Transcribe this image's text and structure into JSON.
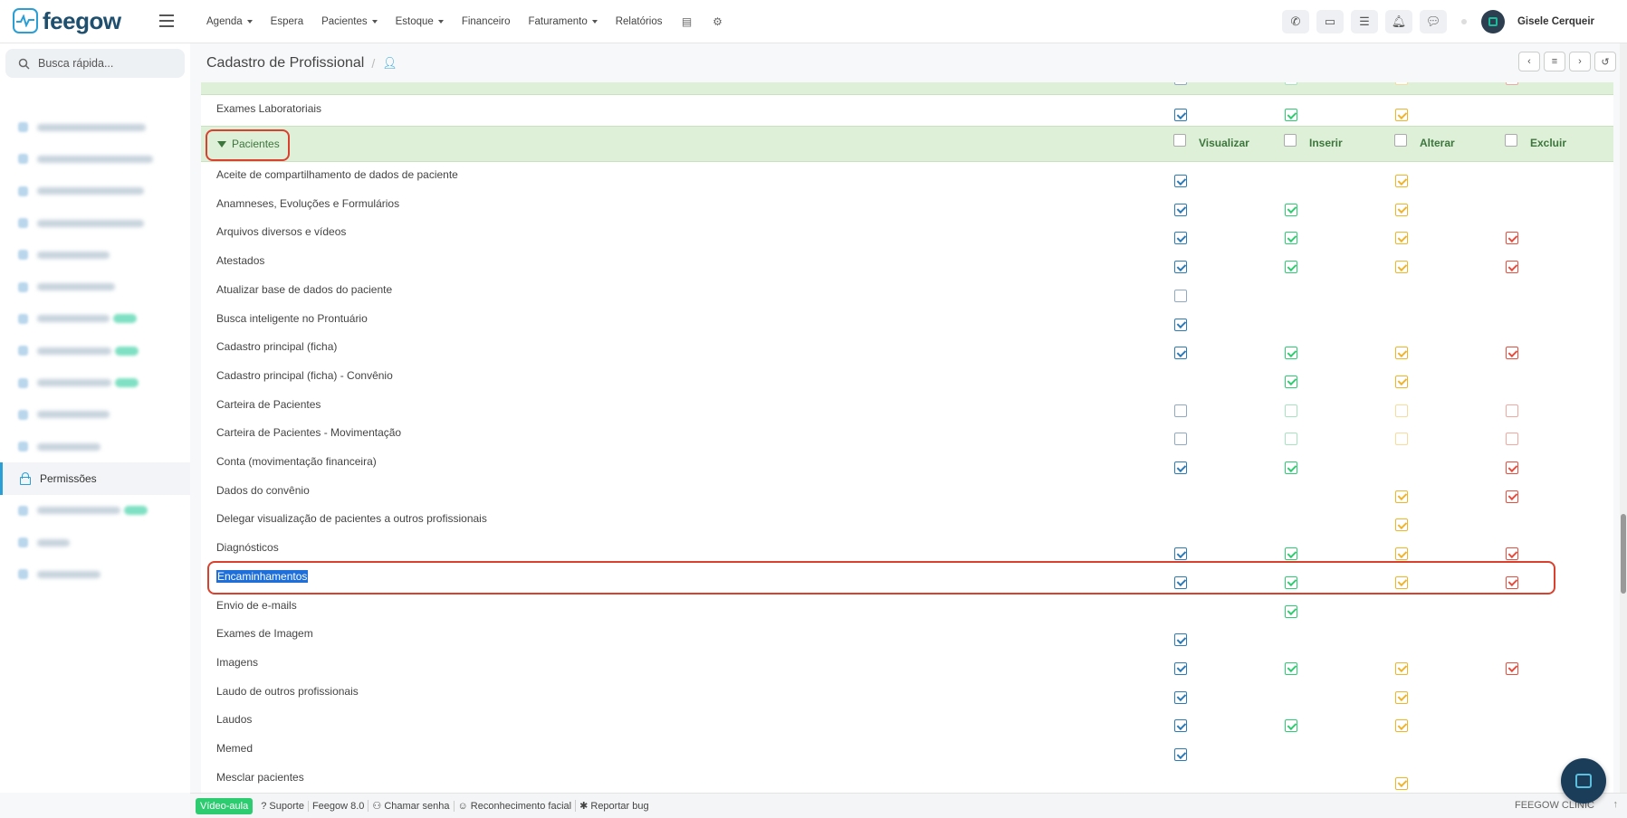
{
  "brand": {
    "name": "feegow"
  },
  "nav": [
    {
      "label": "Agenda",
      "dropdown": true
    },
    {
      "label": "Espera",
      "dropdown": false
    },
    {
      "label": "Pacientes",
      "dropdown": true
    },
    {
      "label": "Estoque",
      "dropdown": true
    },
    {
      "label": "Financeiro",
      "dropdown": false
    },
    {
      "label": "Faturamento",
      "dropdown": true
    },
    {
      "label": "Relatórios",
      "dropdown": false
    }
  ],
  "user": {
    "name": "Gisele Cerqueir"
  },
  "search": {
    "placeholder": "Busca rápida..."
  },
  "sidebar": {
    "active_label": "Permissões"
  },
  "page": {
    "title": "Cadastro de Profissional"
  },
  "group_header": {
    "title": "Pacientes",
    "columns": [
      "Visualizar",
      "Inserir",
      "Alterar",
      "Excluir"
    ]
  },
  "top_row": {
    "name": "Exames Laboratoriais",
    "checks": [
      1,
      1,
      1,
      null
    ]
  },
  "permissions": [
    {
      "name": "Aceite de compartilhamento de dados de paciente",
      "checks": [
        1,
        null,
        1,
        null
      ]
    },
    {
      "name": "Anamneses, Evoluções e Formulários",
      "checks": [
        1,
        1,
        1,
        null
      ]
    },
    {
      "name": "Arquivos diversos e vídeos",
      "checks": [
        1,
        1,
        1,
        1
      ]
    },
    {
      "name": "Atestados",
      "checks": [
        1,
        1,
        1,
        1
      ]
    },
    {
      "name": "Atualizar base de dados do paciente",
      "checks": [
        0,
        null,
        null,
        null
      ]
    },
    {
      "name": "Busca inteligente no Prontuário",
      "checks": [
        1,
        null,
        null,
        null
      ]
    },
    {
      "name": "Cadastro principal (ficha)",
      "checks": [
        1,
        1,
        1,
        1
      ]
    },
    {
      "name": "Cadastro principal (ficha) - Convênio",
      "checks": [
        null,
        1,
        1,
        null
      ]
    },
    {
      "name": "Carteira de Pacientes",
      "checks": [
        0,
        0,
        0,
        0
      ]
    },
    {
      "name": "Carteira de Pacientes - Movimentação",
      "checks": [
        0,
        0,
        0,
        0
      ]
    },
    {
      "name": "Conta (movimentação financeira)",
      "checks": [
        1,
        1,
        null,
        1
      ]
    },
    {
      "name": "Dados do convênio",
      "checks": [
        null,
        null,
        1,
        1
      ]
    },
    {
      "name": "Delegar visualização de pacientes a outros profissionais",
      "checks": [
        null,
        null,
        1,
        null
      ]
    },
    {
      "name": "Diagnósticos",
      "checks": [
        1,
        1,
        1,
        1
      ]
    },
    {
      "name": "Encaminhamentos",
      "checks": [
        1,
        1,
        1,
        1
      ],
      "selected": true
    },
    {
      "name": "Envio de e-mails",
      "checks": [
        null,
        1,
        null,
        null
      ]
    },
    {
      "name": "Exames de Imagem",
      "checks": [
        1,
        null,
        null,
        null
      ]
    },
    {
      "name": "Imagens",
      "checks": [
        1,
        1,
        1,
        1
      ]
    },
    {
      "name": "Laudo de outros profissionais",
      "checks": [
        1,
        null,
        1,
        null
      ]
    },
    {
      "name": "Laudos",
      "checks": [
        1,
        1,
        1,
        null
      ]
    },
    {
      "name": "Memed",
      "checks": [
        1,
        null,
        null,
        null
      ]
    },
    {
      "name": "Mesclar pacientes",
      "checks": [
        null,
        null,
        1,
        null
      ]
    }
  ],
  "footer": {
    "video": "Vídeo-aula",
    "items": [
      "Suporte",
      "Feegow 8.0",
      "Chamar senha",
      "Reconhecimento facial",
      "Reportar bug"
    ],
    "brand": "FEEGOW CLINIC"
  }
}
